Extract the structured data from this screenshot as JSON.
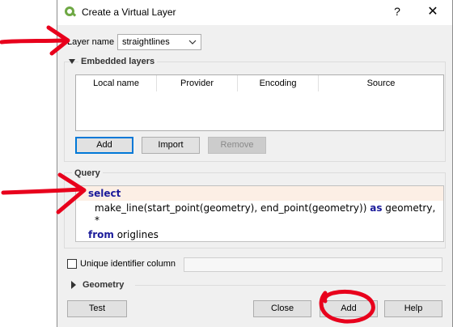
{
  "window": {
    "title": "Create a Virtual Layer",
    "help_symbol": "?",
    "close_symbol": "✕",
    "logo_icon": "qgis-logo-icon"
  },
  "layer_name": {
    "label": "Layer name",
    "value": "straightlines"
  },
  "embedded_layers": {
    "title": "Embedded layers",
    "columns": [
      "Local name",
      "Provider",
      "Encoding",
      "Source"
    ],
    "buttons": {
      "add": "Add",
      "import": "Import",
      "remove": "Remove"
    }
  },
  "query": {
    "title": "Query",
    "lines": [
      {
        "kw": "select",
        "text": ""
      },
      {
        "kw": "",
        "text": "make_line(start_point(geometry), end_point(geometry))"
      },
      {
        "kw": "as",
        "text": " geometry,"
      },
      {
        "kw": "",
        "text": "*"
      },
      {
        "kw": "from",
        "text": " origlines"
      }
    ]
  },
  "unique_id": {
    "label": "Unique identifier column",
    "checked": false
  },
  "geometry": {
    "title": "Geometry"
  },
  "footer": {
    "test": "Test",
    "close": "Close",
    "add": "Add",
    "help": "Help"
  },
  "colors": {
    "annotation_red": "#e8001c",
    "accent_blue": "#0078d7",
    "keyword_blue": "#1a1a9a"
  }
}
